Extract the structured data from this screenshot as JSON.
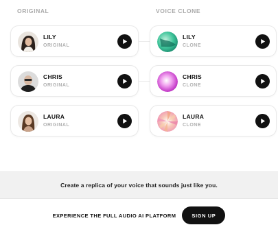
{
  "columns": {
    "original": "ORIGINAL",
    "clone": "VOICE CLONE"
  },
  "rows": [
    {
      "name": "LILY",
      "original_tag": "ORIGINAL",
      "clone_tag": "CLONE"
    },
    {
      "name": "CHRIS",
      "original_tag": "ORIGINAL",
      "clone_tag": "CLONE"
    },
    {
      "name": "LAURA",
      "original_tag": "ORIGINAL",
      "clone_tag": "CLONE"
    }
  ],
  "banner": {
    "text": "Create a replica of your voice that sounds just like you."
  },
  "cta": {
    "text": "EXPERIENCE THE FULL AUDIO AI PLATFORM",
    "button": "SIGN UP"
  },
  "icons": [
    "play-icon"
  ],
  "colors": {
    "button": "#111111",
    "banner_bg": "#f1f1f1",
    "muted_text": "#a9a9a9"
  }
}
